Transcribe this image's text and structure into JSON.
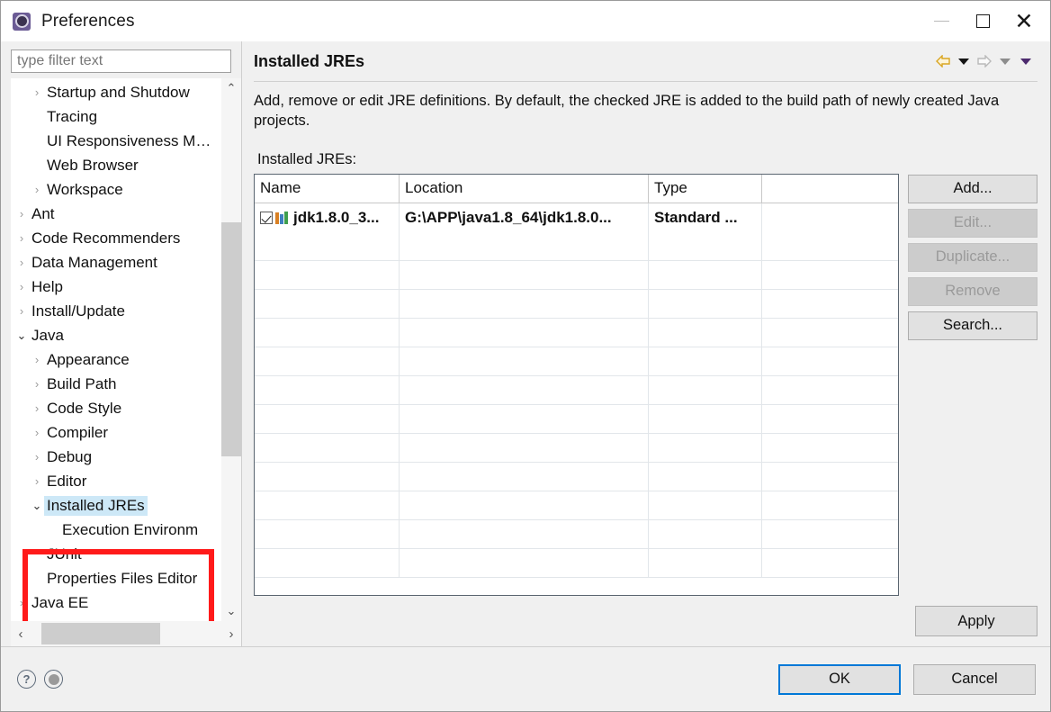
{
  "window": {
    "title": "Preferences",
    "icon": "preferences-gear-icon",
    "controls": {
      "minimize": "—",
      "maximize": "□",
      "close": "✕"
    }
  },
  "sidebar": {
    "filter": {
      "placeholder": "type filter text",
      "value": ""
    },
    "items": [
      {
        "label": "Startup and Shutdow",
        "indent": 2,
        "twisty": "collapsed"
      },
      {
        "label": "Tracing",
        "indent": 2,
        "twisty": "none"
      },
      {
        "label": "UI Responsiveness M…",
        "indent": 2,
        "twisty": "none"
      },
      {
        "label": "Web Browser",
        "indent": 2,
        "twisty": "none"
      },
      {
        "label": "Workspace",
        "indent": 2,
        "twisty": "collapsed"
      },
      {
        "label": "Ant",
        "indent": 1,
        "twisty": "collapsed"
      },
      {
        "label": "Code Recommenders",
        "indent": 1,
        "twisty": "collapsed"
      },
      {
        "label": "Data Management",
        "indent": 1,
        "twisty": "collapsed"
      },
      {
        "label": "Help",
        "indent": 1,
        "twisty": "collapsed"
      },
      {
        "label": "Install/Update",
        "indent": 1,
        "twisty": "collapsed"
      },
      {
        "label": "Java",
        "indent": 1,
        "twisty": "expanded"
      },
      {
        "label": "Appearance",
        "indent": 2,
        "twisty": "collapsed"
      },
      {
        "label": "Build Path",
        "indent": 2,
        "twisty": "collapsed"
      },
      {
        "label": "Code Style",
        "indent": 2,
        "twisty": "collapsed"
      },
      {
        "label": "Compiler",
        "indent": 2,
        "twisty": "collapsed"
      },
      {
        "label": "Debug",
        "indent": 2,
        "twisty": "collapsed"
      },
      {
        "label": "Editor",
        "indent": 2,
        "twisty": "collapsed"
      },
      {
        "label": "Installed JREs",
        "indent": 2,
        "twisty": "expanded",
        "selected": true
      },
      {
        "label": "Execution Environm",
        "indent": 3,
        "twisty": "none"
      },
      {
        "label": "JUnit",
        "indent": 2,
        "twisty": "none"
      },
      {
        "label": "Properties Files Editor",
        "indent": 2,
        "twisty": "none"
      },
      {
        "label": "Java EE",
        "indent": 1,
        "twisty": "collapsed"
      }
    ],
    "scroll": {
      "up_arrow": "⌃",
      "down_arrow": "⌄",
      "left_arrow": "‹",
      "right_arrow": "›"
    }
  },
  "annotation": {
    "shape": "rectangle",
    "color": "#ff1a1a",
    "targets": "Installed JREs / Execution Environments"
  },
  "page": {
    "title": "Installed JREs",
    "nav": {
      "back_icon": "back-arrow-icon",
      "back_dropdown_icon": "dropdown-triangle-icon",
      "forward_icon": "forward-arrow-icon",
      "forward_dropdown_icon": "dropdown-triangle-icon",
      "menu_dropdown_icon": "view-menu-triangle-icon"
    },
    "description": "Add, remove or edit JRE definitions. By default, the checked JRE is added to the build path of newly created Java projects.",
    "list_label": "Installed JREs:"
  },
  "table": {
    "columns": [
      "Name",
      "Location",
      "Type",
      ""
    ],
    "rows": [
      {
        "checked": true,
        "icon": "jre-library-icon",
        "name": "jdk1.8.0_3...",
        "location": "G:\\APP\\java1.8_64\\jdk1.8.0...",
        "type": "Standard ...",
        "extra": ""
      }
    ],
    "empty_row_count": 12
  },
  "side_buttons": [
    {
      "label": "Add...",
      "enabled": true
    },
    {
      "label": "Edit...",
      "enabled": false
    },
    {
      "label": "Duplicate...",
      "enabled": false
    },
    {
      "label": "Remove",
      "enabled": false
    },
    {
      "label": "Search...",
      "enabled": true
    }
  ],
  "apply_button": {
    "label": "Apply",
    "enabled": true
  },
  "footer": {
    "help_icon": "help-question-icon",
    "help_glyph": "?",
    "menu_icon": "shell-menu-icon",
    "ok": "OK",
    "cancel": "Cancel"
  },
  "colors": {
    "accent": "#0078d7",
    "selection": "#cde8f7",
    "annotation": "#ff1a1a",
    "dialog_bg": "#f0f0f0"
  }
}
